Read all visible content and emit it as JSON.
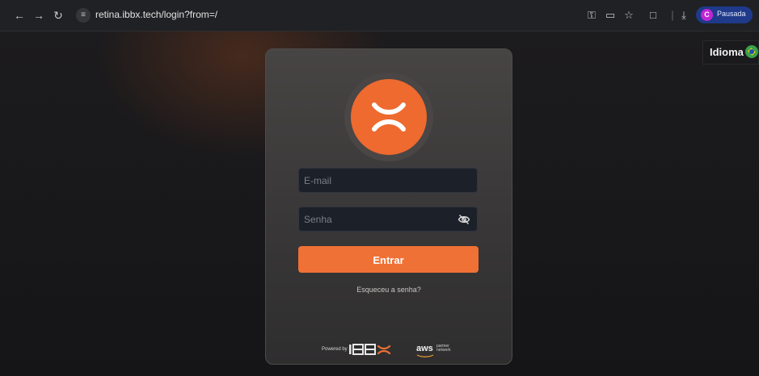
{
  "browser": {
    "url": "retina.ibbx.tech/login?from=/",
    "profile": {
      "initial": "C",
      "name": "Pausada"
    }
  },
  "header": {
    "language_label": "Idioma"
  },
  "login": {
    "email_placeholder": "E-mail",
    "password_placeholder": "Senha",
    "submit_label": "Entrar",
    "forgot_link": "Esqueceu a senha?"
  },
  "footer": {
    "powered_by": "Powered by",
    "brand": "IBBX",
    "partner_logo": "aws",
    "partner_text": "partner network"
  },
  "colors": {
    "accent": "#f07135",
    "logo_bg": "#ee6a2f",
    "card_bg": "#3b3939",
    "input_bg": "#1c2029"
  },
  "icons": {
    "back": "arrow-left-icon",
    "forward": "arrow-right-icon",
    "reload": "reload-icon",
    "site_info": "site-settings-icon",
    "password_key": "key-icon",
    "cast": "cast-icon",
    "bookmark": "star-icon",
    "extensions": "puzzle-icon",
    "download": "download-icon",
    "flag": "brazil-flag-icon",
    "eye": "eye-off-icon"
  }
}
